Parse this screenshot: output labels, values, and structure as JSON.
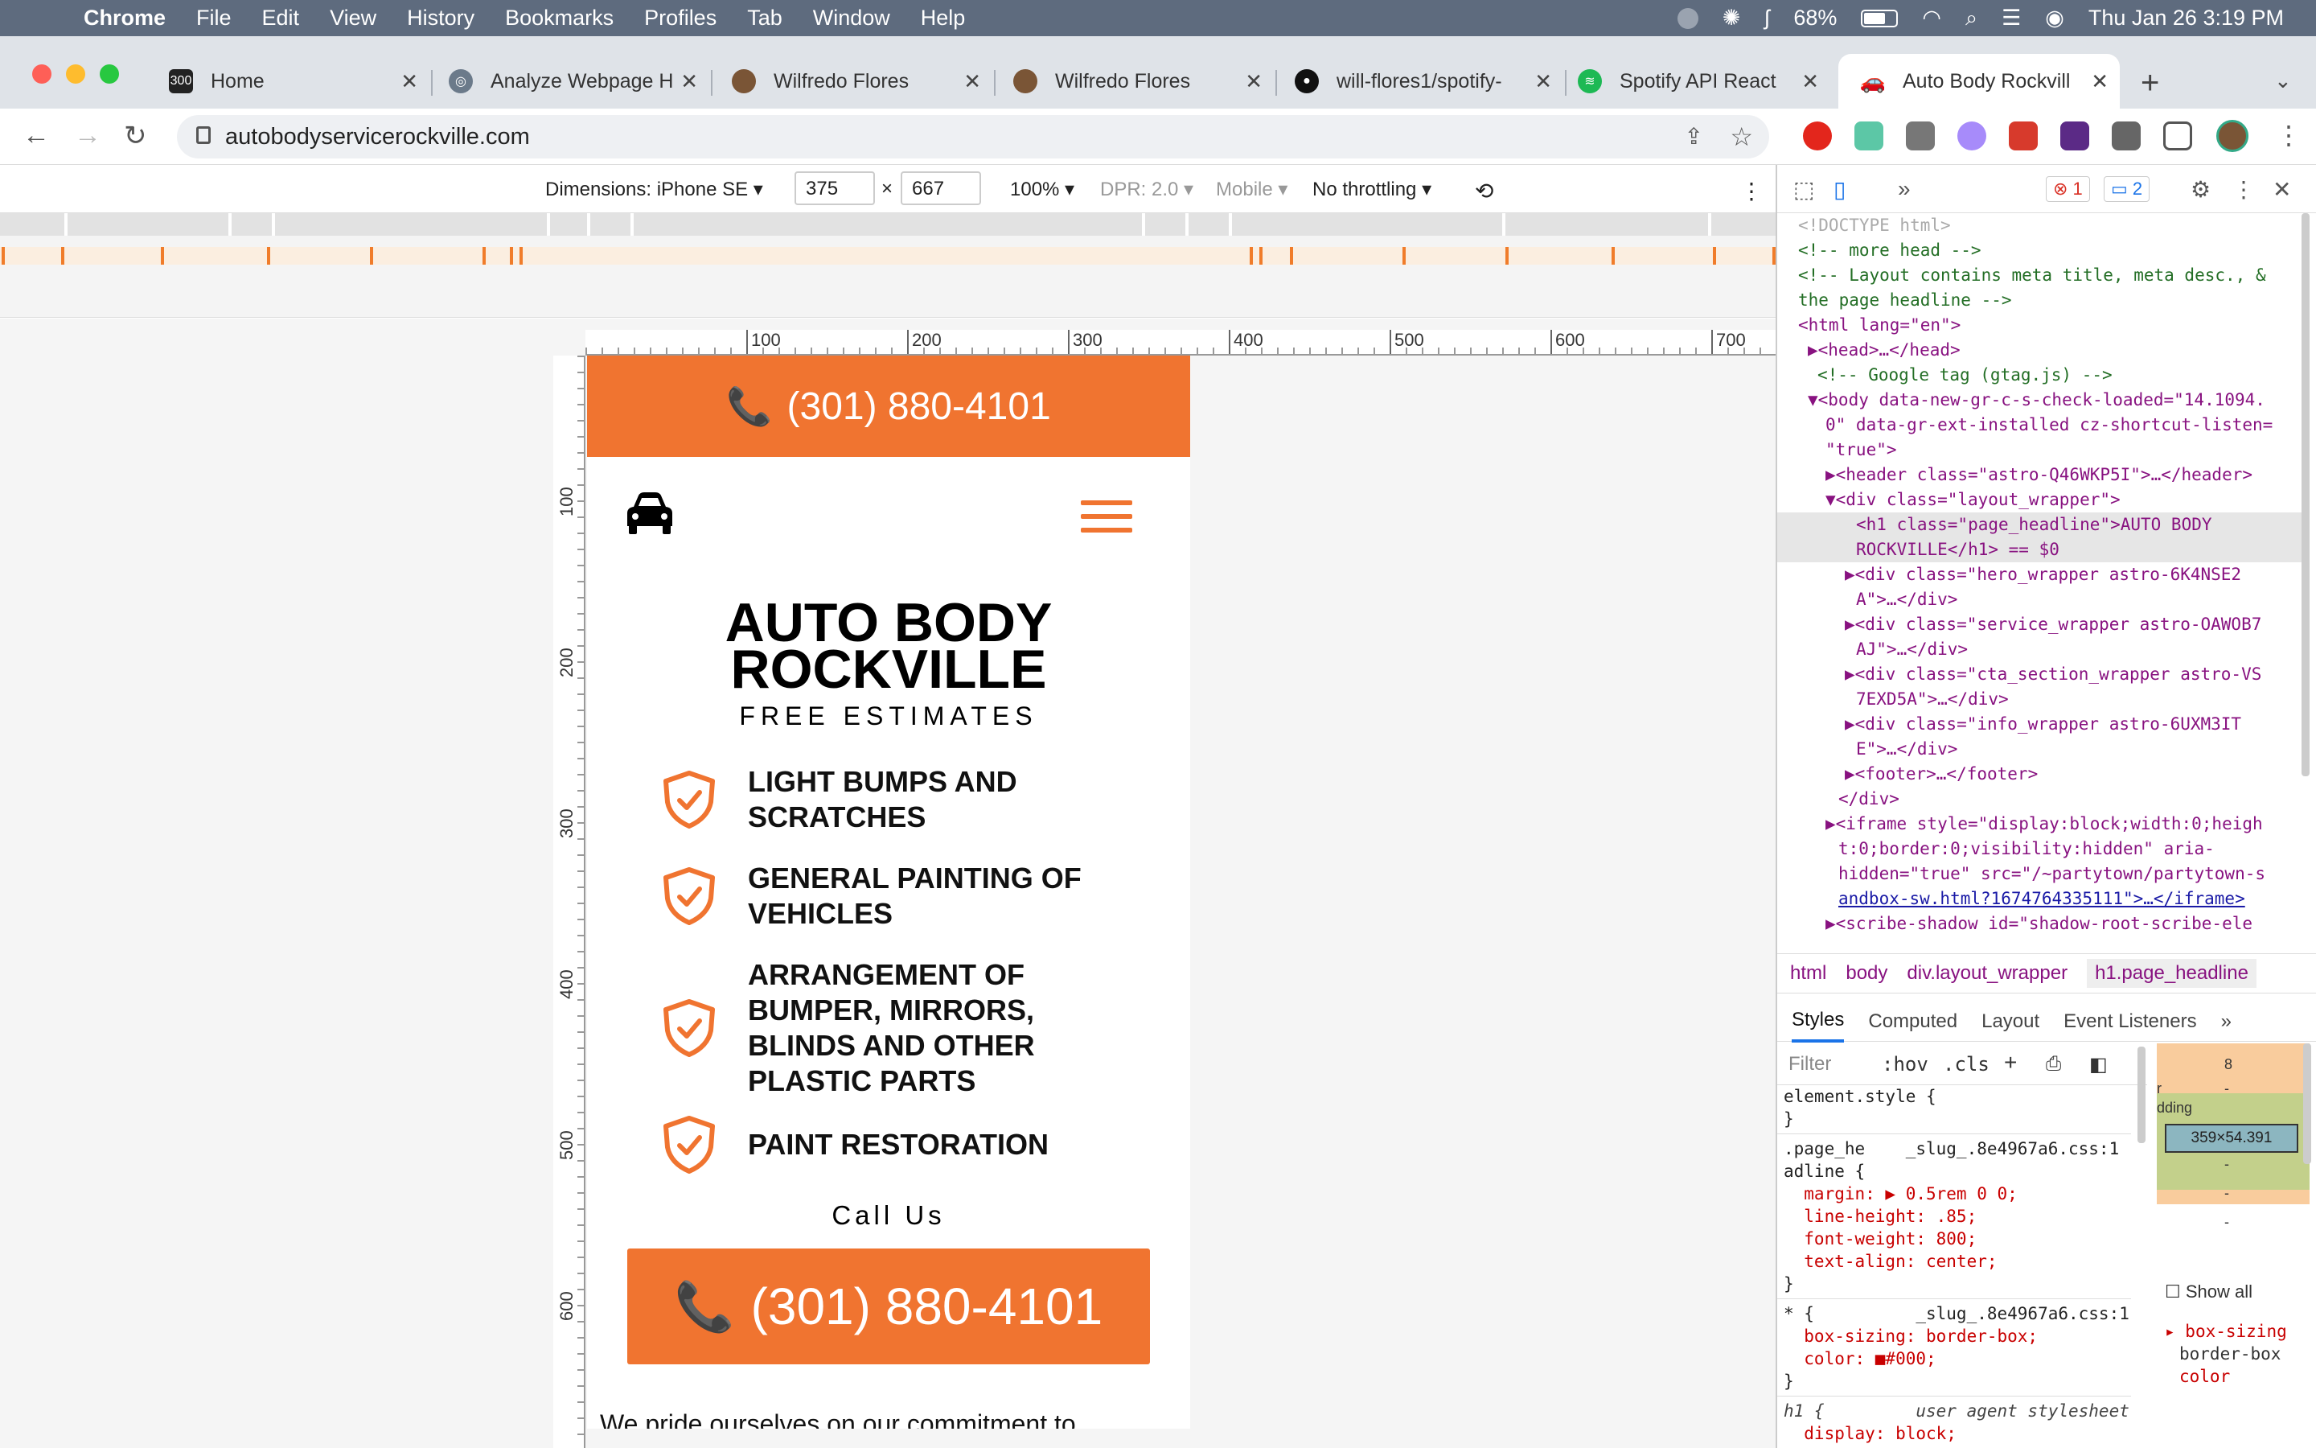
{
  "menubar": {
    "app": "Chrome",
    "items": [
      "File",
      "Edit",
      "View",
      "History",
      "Bookmarks",
      "Profiles",
      "Tab",
      "Window",
      "Help"
    ],
    "battery": "68%",
    "clock": "Thu Jan 26  3:19 PM"
  },
  "tabs": [
    {
      "title": "Home",
      "color": "#222222"
    },
    {
      "title": "Analyze Webpage H",
      "color": "#6b7a8a"
    },
    {
      "title": "Wilfredo Flores",
      "color": "#7a5536"
    },
    {
      "title": "Wilfredo Flores",
      "color": "#7a5536"
    },
    {
      "title": "will-flores1/spotify-",
      "color": "#111111"
    },
    {
      "title": "Spotify API React",
      "color": "#1db954"
    },
    {
      "title": "Auto Body Rockvill",
      "color": "#222222"
    }
  ],
  "address": {
    "url": "autobodyservicerockville.com"
  },
  "device_toolbar": {
    "dimensions": "Dimensions: iPhone SE",
    "width": "375",
    "height": "667",
    "zoom": "100%",
    "dpr": "DPR: 2.0",
    "mode": "Mobile",
    "throttling": "No throttling"
  },
  "ruler": {
    "h_ticks": [
      "100",
      "200",
      "300",
      "400",
      "500",
      "600",
      "700"
    ],
    "v_ticks": [
      "100",
      "200",
      "300",
      "400",
      "500",
      "600"
    ]
  },
  "page": {
    "phone_top": "(301) 880-4101",
    "headline_line1": "AUTO BODY",
    "headline_line2": "ROCKVILLE",
    "tagline": "FREE ESTIMATES",
    "services": [
      [
        "LIGHT BUMPS AND",
        "SCRATCHES"
      ],
      [
        "GENERAL PAINTING OF",
        "VEHICLES"
      ],
      [
        "ARRANGEMENT OF",
        "BUMPER, MIRRORS,",
        "BLINDS AND OTHER",
        "PLASTIC PARTS"
      ],
      [
        "PAINT RESTORATION"
      ]
    ],
    "call_us": "Call Us",
    "cta_phone": "(301) 880-4101",
    "pride": "We pride ourselves on our commitment to",
    "accent": "#f07430"
  },
  "devtools": {
    "errors": "1",
    "messages": "2",
    "dom": [
      "<!DOCTYPE html>",
      "<!-- more head -->",
      "<!-- Layout contains meta title, meta desc., &",
      "the page headline -->",
      "<html lang=\"en\">",
      "▶<head>…</head>",
      "<!-- Google tag (gtag.js) -->",
      "▼<body data-new-gr-c-s-check-loaded=\"14.1094.",
      "0\" data-gr-ext-installed cz-shortcut-listen=",
      "\"true\">",
      "▶<header class=\"astro-Q46WKP5I\">…</header>",
      "▼<div class=\"layout_wrapper\">",
      "<h1 class=\"page_headline\">AUTO BODY",
      "ROCKVILLE</h1> == $0",
      "▶<div class=\"hero_wrapper astro-6K4NSE2",
      "A\">…</div>",
      "▶<div class=\"service_wrapper astro-OAWOB7",
      "AJ\">…</div>",
      "▶<div class=\"cta_section_wrapper astro-VS",
      "7EXD5A\">…</div>",
      "▶<div class=\"info_wrapper astro-6UXM3IT",
      "E\">…</div>",
      "▶<footer>…</footer>",
      "</div>",
      "▶<iframe style=\"display:block;width:0;heigh",
      "t:0;border:0;visibility:hidden\" aria-",
      "hidden=\"true\" src=\"/~partytown/partytown-s",
      "andbox-sw.html?1674764335111\">…</iframe>",
      "▶<scribe-shadow id=\"shadow-root-scribe-ele"
    ],
    "breadcrumbs": [
      "html",
      "body",
      "div.layout_wrapper",
      "h1.page_headline"
    ],
    "panel_tabs": [
      "Styles",
      "Computed",
      "Layout",
      "Event Listeners"
    ],
    "filter_placeholder": "Filter",
    "hov": ":hov",
    "cls": ".cls",
    "rules": [
      "element.style {",
      "}",
      ".page_he    _slug_.8e4967a6.css:1",
      "adline {",
      "  margin: ▶ 0.5rem 0 0;",
      "  line-height: .85;",
      "  font-weight: 800;",
      "  text-align: center;",
      "}",
      "* {          _slug_.8e4967a6.css:1",
      "  box-sizing: border-box;",
      "  color: ■#000;",
      "}",
      "h1 {         user agent stylesheet",
      "  display: block;"
    ],
    "box_model": {
      "margin": "8",
      "content": "359×54.391",
      "label_padding": "dding",
      "label_margin": "r",
      "dash": "-"
    },
    "show_all": "Show all",
    "computed_prop": "box-sizing",
    "computed_val": "border-box",
    "computed_more": "color"
  }
}
